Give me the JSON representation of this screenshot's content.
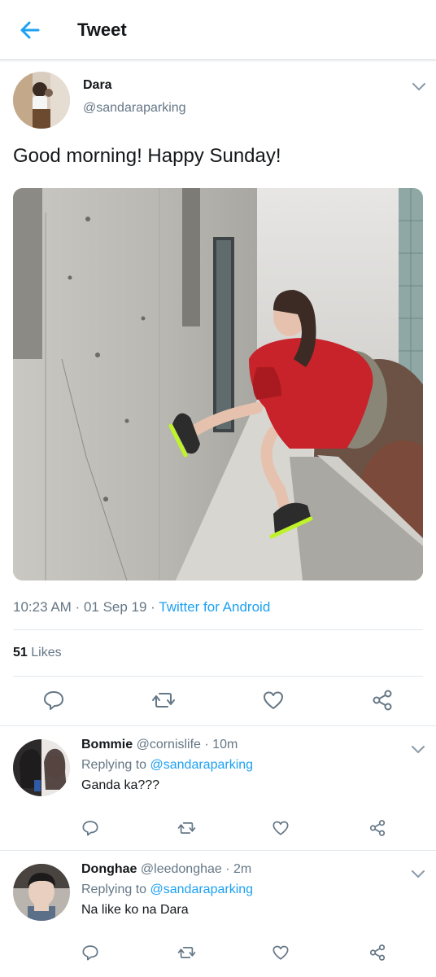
{
  "header": {
    "title": "Tweet",
    "back_icon": "arrow-left-icon"
  },
  "tweet": {
    "author_name": "Dara",
    "author_handle": "@sandaraparking",
    "text": "Good morning! Happy Sunday!",
    "time": "10:23 AM",
    "date": "01 Sep 19",
    "source": "Twitter for Android",
    "likes_count": "51",
    "likes_label": "Likes"
  },
  "replies": [
    {
      "name": "Bommie",
      "handle": "@cornislife",
      "age": "10m",
      "replying_label": "Replying to",
      "replying_handle": "@sandaraparking",
      "text": "Ganda ka???"
    },
    {
      "name": "Donghae",
      "handle": "@leedonghae",
      "age": "2m",
      "replying_label": "Replying to",
      "replying_handle": "@sandaraparking",
      "text": "Na like ko na Dara"
    }
  ],
  "colors": {
    "accent": "#1da1f2",
    "secondary_text": "#657786",
    "primary_text": "#14171a",
    "divider": "#e1e8ed"
  },
  "icons": [
    "arrow-left-icon",
    "chevron-down-icon",
    "reply-icon",
    "retweet-icon",
    "like-icon",
    "share-icon"
  ]
}
